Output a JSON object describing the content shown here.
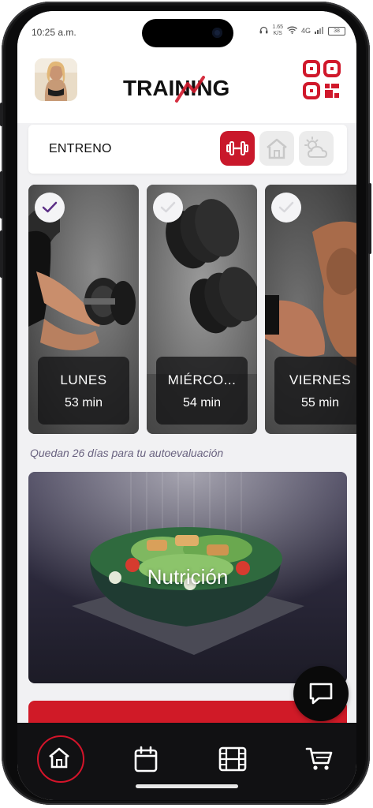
{
  "status_bar": {
    "time": "10:25 a.m.",
    "speed_value": "1.65",
    "speed_unit": "K/S",
    "network": "4G",
    "battery": "38"
  },
  "header": {
    "logo_text": "TRAINING",
    "avatar_icon": "profile-photo",
    "qr_icon": "qr-code-icon"
  },
  "tabs": {
    "label": "ENTRENO",
    "items": [
      {
        "icon": "dumbbell-icon",
        "active": true
      },
      {
        "icon": "home-icon",
        "active": false
      },
      {
        "icon": "weather-icon",
        "active": false
      }
    ]
  },
  "workouts": [
    {
      "day": "LUNES",
      "duration": "53 min",
      "completed": true
    },
    {
      "day": "MIÉRCO...",
      "duration": "54 min",
      "completed": false
    },
    {
      "day": "VIERNES",
      "duration": "55 min",
      "completed": false
    }
  ],
  "eval_text": "Quedan 26 días para tu autoevaluación",
  "nutrition": {
    "title": "Nutrición"
  },
  "bottom_nav": [
    {
      "icon": "home-icon",
      "active": true
    },
    {
      "icon": "calendar-icon",
      "active": false
    },
    {
      "icon": "film-icon",
      "active": false
    },
    {
      "icon": "cart-icon",
      "active": false
    }
  ],
  "colors": {
    "accent": "#d0182b",
    "bg": "#f1f1f3",
    "nav_bg": "#111113",
    "eval_text": "#6a6380"
  }
}
